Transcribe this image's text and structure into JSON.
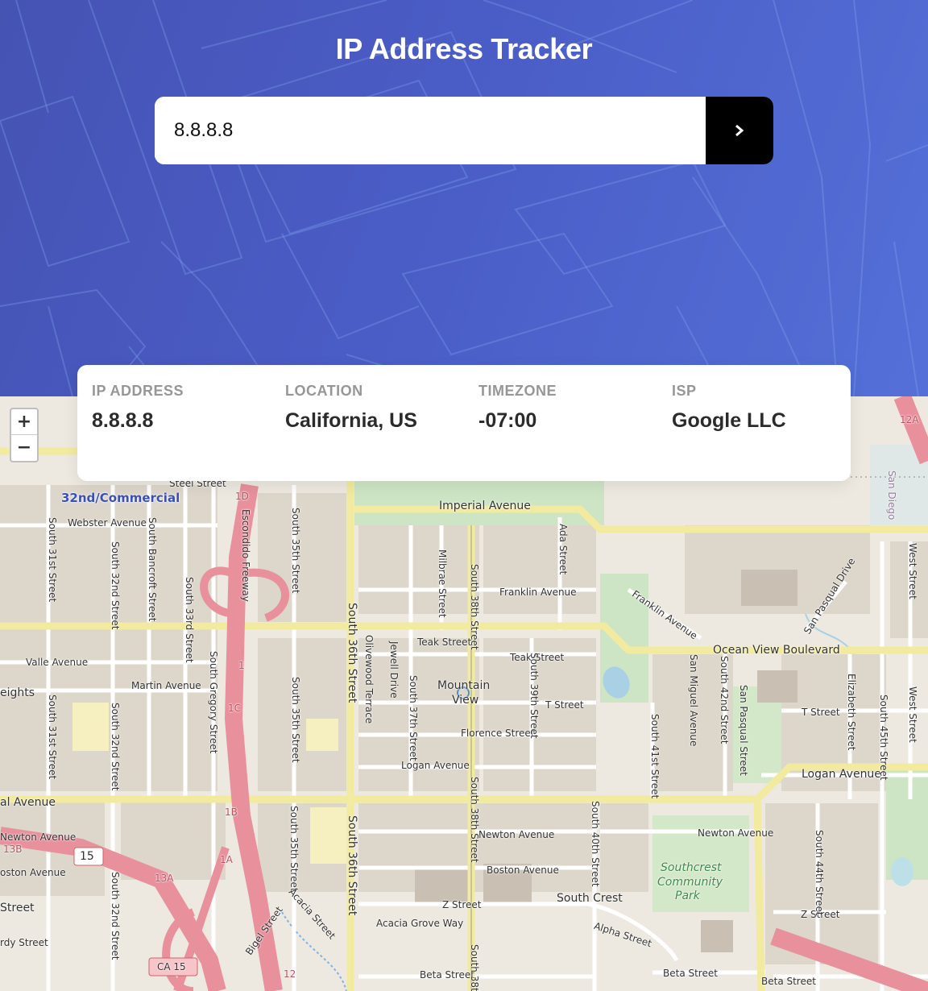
{
  "header": {
    "title": "IP Address Tracker"
  },
  "search": {
    "value": "8.8.8.8",
    "submit_icon": "chevron-right-icon"
  },
  "info": {
    "ip_label": "IP ADDRESS",
    "ip_value": "8.8.8.8",
    "location_label": "LOCATION",
    "location_value": "California, US",
    "timezone_label": "TIMEZONE",
    "timezone_value": "-07:00",
    "isp_label": "ISP",
    "isp_value": "Google LLC"
  },
  "map": {
    "zoom_in": "+",
    "zoom_out": "−",
    "labels": {
      "commercial": "32nd/Commercial",
      "steel": "Steel Street",
      "webster": "Webster Avenue",
      "imperial": "Imperial Avenue",
      "franklin": "Franklin Avenue",
      "franklin2": "Franklin Avenue",
      "teak": "Teak Street",
      "teak2": "Teak Street",
      "ocean": "Ocean View Boulevard",
      "valle": "Valle Avenue",
      "martin": "Martin Avenue",
      "heights": "eights",
      "mountain": "Mountain",
      "view": "View",
      "tstreet": "T Street",
      "tstreet2": "T Street",
      "florence": "Florence Street",
      "logan": "Logan Avenue",
      "logan2": "Logan Avenue",
      "nalave": "al Avenue",
      "newton": "Newton Avenue",
      "newton2": "Newton Avenue",
      "newton3": "Newton Avenue",
      "boston": "Boston Avenue",
      "boston2": "oston Avenue",
      "southcrest": "South Crest",
      "zstreet": "Z Street",
      "zstreet2": "Z Street",
      "acacia": "Acacia Grove Way",
      "alpha": "Alpha Street",
      "beta": "Beta Street",
      "beta2": "Beta Street",
      "beta3": "Beta Street",
      "street": "Street",
      "rdy": "rdy Street",
      "park1": "Southcrest",
      "park2": "Community",
      "park3": "Park",
      "i15": "15",
      "ca15": "CA 15",
      "x1d": "1D",
      "x1c": "1C",
      "x1b": "1B",
      "x1a": "1A",
      "x13a": "13A",
      "x13b": "13B",
      "x12": "12",
      "x12a": "12A",
      "x1": "1",
      "escondido": "Escondido Freeway",
      "s36": "South 36th Street",
      "s36b": "South 36th Street",
      "s32": "South 32nd Street",
      "s32b": "South 32nd Street",
      "s32c": "South 32nd Street",
      "s31": "South 31st Street",
      "s31b": "South 31st Street",
      "s35": "South 35th Street",
      "s35b": "South 35th Street",
      "s35c": "South 35th Street",
      "s37": "South 37th Street",
      "s38": "South 38th Street",
      "s38b": "South 38th Street",
      "s38c": "South 38th",
      "s39": "South 39th Street",
      "s40": "South 40th Street",
      "s41": "South 41st Street",
      "s42": "South 42nd Street",
      "s44": "South 44th Street",
      "s45": "South 45th Street",
      "milbrae": "Milbrae Street",
      "ada": "Ada Street",
      "jewell": "Jewell Drive",
      "olivewood": "Olivewood Terrace",
      "bancroft": "South Bancroft Street",
      "s33": "South 33rd Street",
      "gregory": "South Gregory Street",
      "sanmiguel": "San Miguel Avenue",
      "sanpasqual": "San Pasqual Street",
      "sanpasqualdr": "San Pasqual Drive",
      "elizabeth": "Elizabeth Street",
      "west": "West Street",
      "west2": "West Street",
      "sandiego": "San Diego",
      "bigel": "Bigel Street",
      "acaciast": "Acacia Street"
    }
  }
}
